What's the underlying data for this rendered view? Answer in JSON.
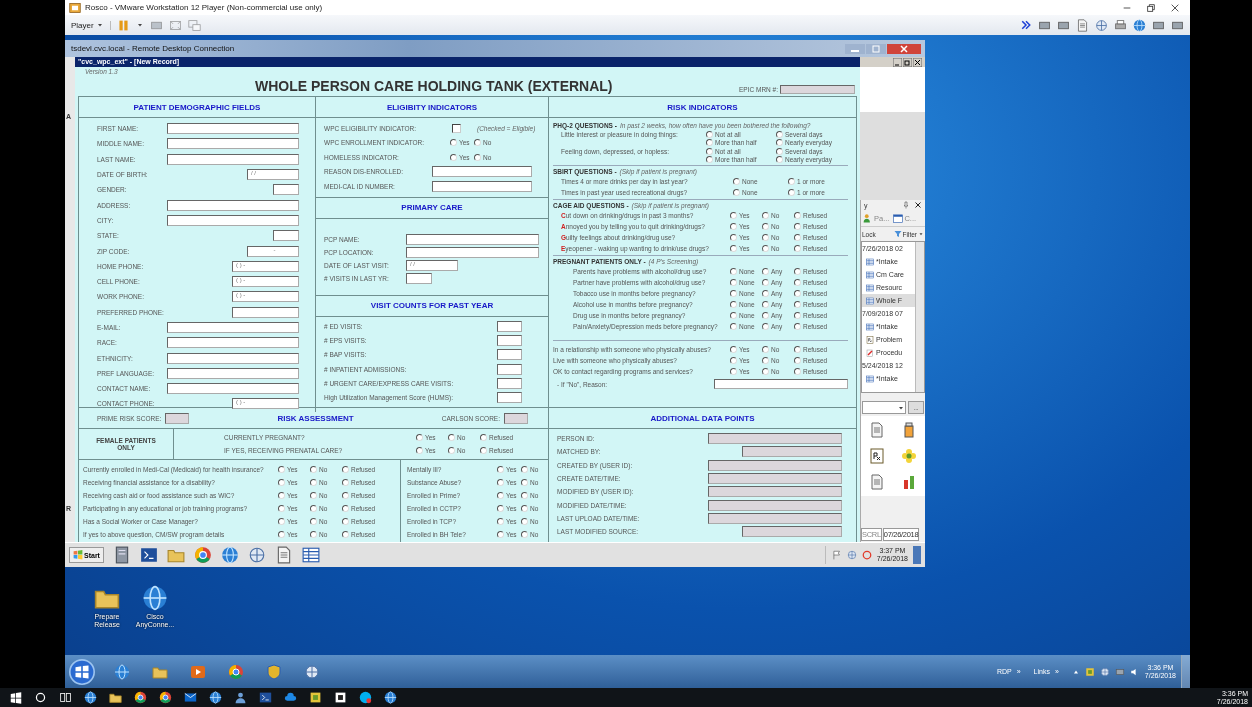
{
  "vmware": {
    "title": "Rosco - VMware Workstation 12 Player (Non-commercial use only)",
    "menu": "Player"
  },
  "rdp": {
    "title": "tsdevl.cvc.local - Remote Desktop Connection"
  },
  "form_window": {
    "title": "\"cvc_wpc_ext\" - [New Record]"
  },
  "left_strip": [
    "A",
    "R"
  ],
  "form": {
    "version": "Version 1.3",
    "title": "WHOLE PERSON CARE HOLDING TANK (EXTERNAL)",
    "epic_mrn_label": "EPIC MRN #:",
    "demographics": {
      "heading": "PATIENT DEMOGRAPHIC FIELDS",
      "fields": [
        {
          "label": "FIRST NAME:",
          "kind": "wide"
        },
        {
          "label": "MIDDLE NAME:",
          "kind": "wide"
        },
        {
          "label": "LAST NAME:",
          "kind": "wide"
        },
        {
          "label": "DATE OF BIRTH:",
          "kind": "date",
          "value": "/ /"
        },
        {
          "label": "GENDER:",
          "kind": "small"
        },
        {
          "label": "ADDRESS:",
          "kind": "wide"
        },
        {
          "label": "CITY:",
          "kind": "wide"
        },
        {
          "label": "STATE:",
          "kind": "small"
        },
        {
          "label": "ZIP CODE:",
          "kind": "zip",
          "value": "-"
        },
        {
          "label": "HOME PHONE:",
          "kind": "phone",
          "value": "( ) -"
        },
        {
          "label": "CELL PHONE:",
          "kind": "phone",
          "value": "( ) -"
        },
        {
          "label": "WORK PHONE:",
          "kind": "phone",
          "value": "( ) -"
        },
        {
          "label": "PREFERRED PHONE:",
          "kind": "phone"
        },
        {
          "label": "E-MAIL:",
          "kind": "wide"
        },
        {
          "label": "RACE:",
          "kind": "wide"
        },
        {
          "label": "ETHNICITY:",
          "kind": "wide"
        },
        {
          "label": "PREF LANGUAGE:",
          "kind": "wide"
        },
        {
          "label": "CONTACT NAME:",
          "kind": "wide"
        },
        {
          "label": "CONTACT PHONE:",
          "kind": "phone",
          "value": "( ) -"
        }
      ]
    },
    "eligibility": {
      "heading": "ELIGIBITY INDICATORS",
      "items": [
        {
          "kind": "checkbox",
          "label": "WPC ELIGIBILITY INDICATOR:",
          "checked": false,
          "note": "(Checked = Eligible)"
        },
        {
          "kind": "radio",
          "label": "WPC ENROLLMENT INDICATOR:",
          "options": [
            {
              "label": "Yes",
              "selected": false
            },
            {
              "label": "No",
              "selected": false
            }
          ]
        },
        {
          "kind": "radio",
          "label": "HOMELESS INDICATOR:",
          "options": [
            {
              "label": "Yes",
              "selected": false
            },
            {
              "label": "No",
              "selected": false
            }
          ]
        },
        {
          "kind": "field",
          "label": "REASON DIS-ENROLLED:"
        },
        {
          "kind": "field",
          "label": "MEDI-CAL ID NUMBER:"
        }
      ]
    },
    "primary_care": {
      "heading": "PRIMARY CARE",
      "fields": [
        {
          "label": "PCP NAME:",
          "kind": "wide"
        },
        {
          "label": "PCP LOCATION:",
          "kind": "wide"
        },
        {
          "label": "DATE OF LAST VISIT:",
          "kind": "date",
          "value": "/ /"
        },
        {
          "label": "# VISITS IN LAST YR:",
          "kind": "small"
        }
      ]
    },
    "visit_counts": {
      "heading": "VISIT COUNTS FOR PAST YEAR",
      "fields": [
        {
          "label": "# ED VISITS:"
        },
        {
          "label": "# EPS VISITS:"
        },
        {
          "label": "# BAP VISITS:"
        },
        {
          "label": "# INPATIENT ADMISSIONS:"
        },
        {
          "label": "# URGENT CARE/EXPRESS CARE VISITS:"
        },
        {
          "label": "High Utilization Management Score (HUMS):"
        }
      ]
    },
    "risk_indicators": {
      "heading": "RISK INDICATORS",
      "groups": [
        {
          "kind": "grid",
          "title": "PHQ-2 QUESTIONS -",
          "note": "In past 2 weeks, how often have you been bothered the following?",
          "questions": [
            {
              "text": "Little interest or pleasure in doing things:",
              "options": [
                {
                  "label": "Not at all",
                  "selected": false
                },
                {
                  "label": "Several days",
                  "selected": false
                },
                {
                  "label": "More than half",
                  "selected": false
                },
                {
                  "label": "Nearly everyday",
                  "selected": false
                }
              ]
            },
            {
              "text": "Feeling down, depressed, or hopless:",
              "options": [
                {
                  "label": "Not at all",
                  "selected": false
                },
                {
                  "label": "Several days",
                  "selected": false
                },
                {
                  "label": "More than half",
                  "selected": false
                },
                {
                  "label": "Nearly everyday",
                  "selected": false
                }
              ]
            }
          ]
        },
        {
          "kind": "row",
          "title": "SBIRT QUESTIONS -",
          "note": "(Skip if patient is pregnant)",
          "questions": [
            {
              "text": "Times 4 or more drinks per day in last year?",
              "options": [
                {
                  "label": "None",
                  "selected": false
                },
                {
                  "label": "1 or more",
                  "selected": false
                }
              ]
            },
            {
              "text": "Times in past year used recreational drugs?",
              "options": [
                {
                  "label": "None",
                  "selected": false
                },
                {
                  "label": "1 or more",
                  "selected": false
                }
              ]
            }
          ]
        },
        {
          "kind": "row",
          "title": "CAGE AID QUESTIONS -",
          "note": "(Skip if patient is pregnant)",
          "questions": [
            {
              "text": "**C**ut down on drinking/drugs in past 3 months?",
              "options": [
                {
                  "label": "Yes",
                  "selected": false
                },
                {
                  "label": "No",
                  "selected": false
                },
                {
                  "label": "Refused",
                  "selected": false
                }
              ]
            },
            {
              "text": "**A**nnoyed you by telling you to quit drinking/drugs?",
              "options": [
                {
                  "label": "Yes",
                  "selected": false
                },
                {
                  "label": "No",
                  "selected": false
                },
                {
                  "label": "Refused",
                  "selected": false
                }
              ]
            },
            {
              "text": "**G**uilty feelings about drinking/drug use?",
              "options": [
                {
                  "label": "Yes",
                  "selected": false
                },
                {
                  "label": "No",
                  "selected": false
                },
                {
                  "label": "Refused",
                  "selected": false
                }
              ]
            },
            {
              "text": "**E**yeopener - waking up wanting to drink/use drugs?",
              "options": [
                {
                  "label": "Yes",
                  "selected": false
                },
                {
                  "label": "No",
                  "selected": false
                },
                {
                  "label": "Refused",
                  "selected": false
                }
              ]
            }
          ]
        },
        {
          "kind": "row",
          "title": "PREGNANT PATIENTS ONLY -",
          "note": "(4 P's Screening)",
          "questions": [
            {
              "text": "Parents have problems with alcohol/drug use?",
              "options": [
                {
                  "label": "None",
                  "selected": false
                },
                {
                  "label": "Any",
                  "selected": false
                },
                {
                  "label": "Refused",
                  "selected": false
                }
              ]
            },
            {
              "text": "Partner have problems with alcohol/drug use?",
              "options": [
                {
                  "label": "None",
                  "selected": false
                },
                {
                  "label": "Any",
                  "selected": false
                },
                {
                  "label": "Refused",
                  "selected": false
                }
              ]
            },
            {
              "text": "Tobacco use in months before pregnancy?",
              "options": [
                {
                  "label": "None",
                  "selected": false
                },
                {
                  "label": "Any",
                  "selected": false
                },
                {
                  "label": "Refused",
                  "selected": false
                }
              ]
            },
            {
              "text": "Alcohol use in months before pregnancy?",
              "options": [
                {
                  "label": "None",
                  "selected": false
                },
                {
                  "label": "Any",
                  "selected": false
                },
                {
                  "label": "Refused",
                  "selected": false
                }
              ]
            },
            {
              "text": "Drug use in months before pregnancy?",
              "options": [
                {
                  "label": "None",
                  "selected": false
                },
                {
                  "label": "Any",
                  "selected": false
                },
                {
                  "label": "Refused",
                  "selected": false
                }
              ]
            },
            {
              "text": "Pain/Anxiety/Depression meds before pregnancy?",
              "options": [
                {
                  "label": "None",
                  "selected": false
                },
                {
                  "label": "Any",
                  "selected": false
                },
                {
                  "label": "Refused",
                  "selected": false
                }
              ]
            }
          ]
        },
        {
          "kind": "row",
          "questions": [
            {
              "text": "In a relationship with someone who physically abuses?",
              "options": [
                {
                  "label": "Yes",
                  "selected": false
                },
                {
                  "label": "No",
                  "selected": false
                },
                {
                  "label": "Refused",
                  "selected": false
                }
              ]
            },
            {
              "text": "Live with someone who physically abuses?",
              "options": [
                {
                  "label": "Yes",
                  "selected": false
                },
                {
                  "label": "No",
                  "selected": false
                },
                {
                  "label": "Refused",
                  "selected": false
                }
              ]
            },
            {
              "text": "OK to contact regarding programs and services?",
              "options": [
                {
                  "label": "Yes",
                  "selected": false
                },
                {
                  "label": "No",
                  "selected": false
                },
                {
                  "label": "Refused",
                  "selected": false
                }
              ]
            }
          ]
        }
      ],
      "reason_label": "- If \"No\", Reason:"
    },
    "risk_assessment": {
      "heading": "RISK ASSESSMENT",
      "prime_label": "PRIME RISK SCORE:",
      "carlson_label": "CARLSON SCORE:",
      "female": {
        "label": "FEMALE PATIENTS ONLY",
        "questions": [
          {
            "text": "CURRENTLY PREGNANT?",
            "options": [
              {
                "label": "Yes",
                "selected": false
              },
              {
                "label": "No",
                "selected": false
              },
              {
                "label": "Refused",
                "selected": false
              }
            ]
          },
          {
            "text": "IF YES, RECEIVING PRENATAL CARE?",
            "options": [
              {
                "label": "Yes",
                "selected": false
              },
              {
                "label": "No",
                "selected": false
              },
              {
                "label": "Refused",
                "selected": false
              }
            ]
          }
        ]
      },
      "left_questions": [
        {
          "text": "Currently enrolled in Medi-Cal (Medicaid) for health insurance?",
          "options": [
            {
              "label": "Yes",
              "selected": false
            },
            {
              "label": "No",
              "selected": false
            },
            {
              "label": "Refused",
              "selected": false
            }
          ]
        },
        {
          "text": "Receiving financial assistance for a disability?",
          "options": [
            {
              "label": "Yes",
              "selected": false
            },
            {
              "label": "No",
              "selected": false
            },
            {
              "label": "Refused",
              "selected": false
            }
          ]
        },
        {
          "text": "Receiving cash aid or food assistance such as WIC?",
          "options": [
            {
              "label": "Yes",
              "selected": false
            },
            {
              "label": "No",
              "selected": false
            },
            {
              "label": "Refused",
              "selected": false
            }
          ]
        },
        {
          "text": "Participating in any educational or job training programs?",
          "options": [
            {
              "label": "Yes",
              "selected": false
            },
            {
              "label": "No",
              "selected": false
            },
            {
              "label": "Refused",
              "selected": false
            }
          ]
        },
        {
          "text": "Has a Social Worker or Case Manager?",
          "options": [
            {
              "label": "Yes",
              "selected": false
            },
            {
              "label": "No",
              "selected": false
            },
            {
              "label": "Refused",
              "selected": false
            }
          ]
        },
        {
          "text": "If yes to above question, CM/SW program details",
          "options": [
            {
              "label": "Yes",
              "selected": false
            },
            {
              "label": "No",
              "selected": false
            },
            {
              "label": "Refused",
              "selected": false
            }
          ]
        }
      ],
      "right_questions": [
        {
          "text": "Mentally Ill?",
          "options": [
            {
              "label": "Yes",
              "selected": false
            },
            {
              "label": "No",
              "selected": false
            }
          ]
        },
        {
          "text": "Substance Abuse?",
          "options": [
            {
              "label": "Yes",
              "selected": false
            },
            {
              "label": "No",
              "selected": false
            }
          ]
        },
        {
          "text": "Enrolled in Prime?",
          "options": [
            {
              "label": "Yes",
              "selected": false
            },
            {
              "label": "No",
              "selected": false
            }
          ]
        },
        {
          "text": "Enrolled in CCTP?",
          "options": [
            {
              "label": "Yes",
              "selected": false
            },
            {
              "label": "No",
              "selected": false
            }
          ]
        },
        {
          "text": "Enrolled in TCP?",
          "options": [
            {
              "label": "Yes",
              "selected": false
            },
            {
              "label": "No",
              "selected": false
            }
          ]
        },
        {
          "text": "Enrolled in BH Tele?",
          "options": [
            {
              "label": "Yes",
              "selected": false
            },
            {
              "label": "No",
              "selected": false
            }
          ]
        }
      ]
    },
    "additional": {
      "heading": "ADDITIONAL DATA POINTS",
      "fields": [
        {
          "label": "PERSON ID:",
          "kind": "wide"
        },
        {
          "label": "MATCHED BY:",
          "kind": "short"
        },
        {
          "label": "CREATED BY (USER ID):",
          "kind": "wide"
        },
        {
          "label": "CREATE DATE/TIME:",
          "kind": "wide"
        },
        {
          "label": "MODIFIED BY (USER ID):",
          "kind": "wide"
        },
        {
          "label": "MODIFIED DATE/TIME:",
          "kind": "wide"
        },
        {
          "label": "LAST UPLOAD DATE/TIME:",
          "kind": "wide"
        },
        {
          "label": "LAST MODIFIED SOURCE:",
          "kind": "short"
        }
      ]
    }
  },
  "side_panel": {
    "title": "y",
    "tabs": [
      {
        "label": "Pa...",
        "selected": false
      },
      {
        "label": "C...",
        "selected": false
      }
    ],
    "lock": "Lock",
    "filter": "Filter",
    "items": [
      {
        "kind": "date",
        "text": "7/26/2018 02",
        "selected": false
      },
      {
        "kind": "form",
        "text": "*Intake",
        "selected": false
      },
      {
        "kind": "form",
        "text": "Cm Care",
        "selected": false
      },
      {
        "kind": "form",
        "text": "Resourc",
        "selected": false
      },
      {
        "kind": "form",
        "text": "Whole F",
        "selected": true
      },
      {
        "kind": "date",
        "text": "7/09/2018 07",
        "selected": false
      },
      {
        "kind": "form",
        "text": "*Intake",
        "selected": false
      },
      {
        "kind": "dx",
        "text": "Problem",
        "selected": false
      },
      {
        "kind": "procedure",
        "text": "Procedu",
        "selected": false
      },
      {
        "kind": "date",
        "text": "5/24/2018 12",
        "selected": false
      },
      {
        "kind": "form",
        "text": "*Intake",
        "selected": false
      }
    ],
    "more": "...",
    "status": [
      "SCRL",
      "07/26/2018"
    ]
  },
  "remote_taskbar": {
    "start": "Start",
    "time": "3:37 PM",
    "date": "7/26/2018"
  },
  "desktop_icons": [
    {
      "label": "Prepare Release"
    },
    {
      "label": "Cisco AnyConne..."
    }
  ],
  "win7_taskbar": {
    "toolbars": [
      {
        "label": "RDP",
        "chevron": "»"
      },
      {
        "label": "Links",
        "chevron": "»"
      }
    ],
    "time": "3:36 PM",
    "date": "7/26/2018"
  },
  "host_taskbar": {
    "time": "3:36 PM",
    "date": "7/26/2018"
  }
}
